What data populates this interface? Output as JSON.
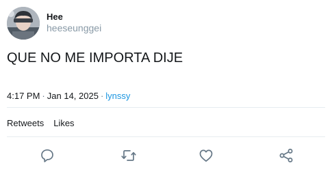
{
  "author": {
    "name": "Hee",
    "handle": "heeseunggei"
  },
  "tweet": {
    "text": "QUE NO ME IMPORTA DIJE"
  },
  "meta": {
    "time": "4:17 PM",
    "date": "Jan 14, 2025",
    "separator": "·",
    "source": "lynssy"
  },
  "stats": {
    "retweets_label": "Retweets",
    "likes_label": "Likes"
  },
  "actions": {
    "reply_icon": "reply-icon",
    "retweet_icon": "retweet-icon",
    "like_icon": "heart-icon",
    "share_icon": "share-icon",
    "icon_color": "#657786"
  },
  "colors": {
    "link": "#1b95e0",
    "handle": "#8899a6",
    "divider": "#e6ecf0"
  }
}
